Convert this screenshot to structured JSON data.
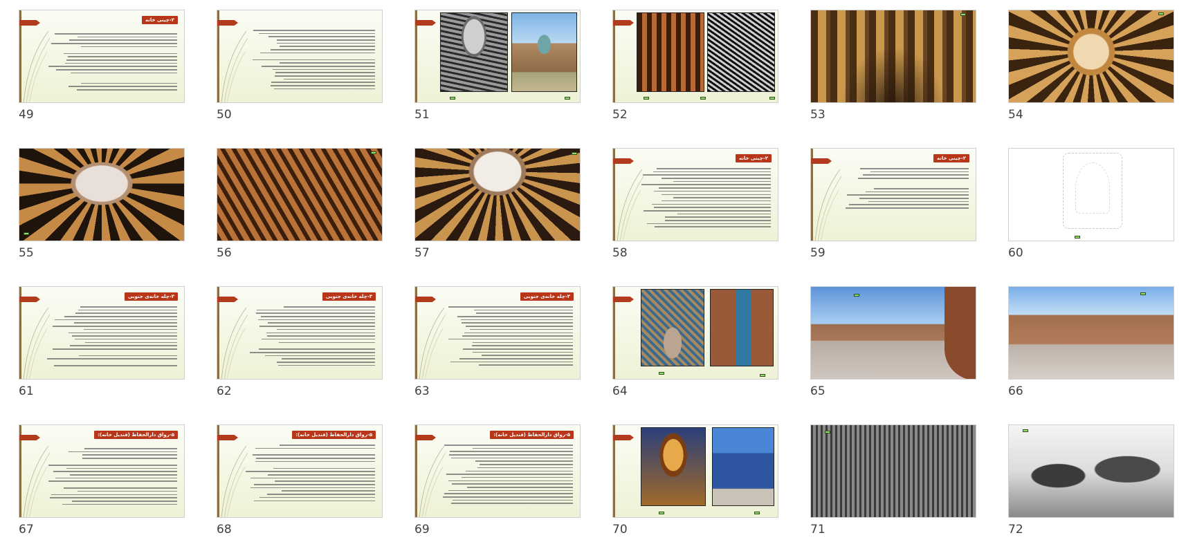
{
  "slides": [
    {
      "num": "49",
      "kind": "text",
      "title": "۲-چینی خانه",
      "layout": "full"
    },
    {
      "num": "50",
      "kind": "text",
      "title": "",
      "layout": "full"
    },
    {
      "num": "51",
      "kind": "two-photos",
      "captions": [
        "",
        "",
        ""
      ]
    },
    {
      "num": "52",
      "kind": "two-photos",
      "captions": [
        "",
        "",
        ""
      ]
    },
    {
      "num": "53",
      "kind": "photo",
      "scene": "interior-niches",
      "captions": [
        ""
      ]
    },
    {
      "num": "54",
      "kind": "photo",
      "scene": "dome-niches",
      "captions": [
        ""
      ]
    },
    {
      "num": "55",
      "kind": "photo",
      "scene": "dome-white",
      "captions": [
        ""
      ]
    },
    {
      "num": "56",
      "kind": "photo",
      "scene": "muqarnas-warm",
      "captions": [
        ""
      ]
    },
    {
      "num": "57",
      "kind": "photo",
      "scene": "dome-wide",
      "captions": [
        ""
      ]
    },
    {
      "num": "58",
      "kind": "text",
      "title": "۲-چینی خانه",
      "layout": "full"
    },
    {
      "num": "59",
      "kind": "text",
      "title": "۲-چینی خانه",
      "layout": "short"
    },
    {
      "num": "60",
      "kind": "sketch",
      "captions": [
        ""
      ]
    },
    {
      "num": "61",
      "kind": "text",
      "title": "۳-چله خانه‌ی جنوبی",
      "layout": "full"
    },
    {
      "num": "62",
      "kind": "text",
      "title": "۳-چله خانه‌ی جنوبی",
      "layout": "full"
    },
    {
      "num": "63",
      "kind": "text",
      "title": "۳-چله خانه‌ی جنوبی",
      "layout": "full"
    },
    {
      "num": "64",
      "kind": "two-arches",
      "captions": [
        "",
        ""
      ]
    },
    {
      "num": "65",
      "kind": "photo",
      "scene": "courtyard",
      "captions": [
        ""
      ]
    },
    {
      "num": "66",
      "kind": "photo",
      "scene": "courtyard2",
      "captions": [
        ""
      ]
    },
    {
      "num": "67",
      "kind": "text",
      "title": "۵-رواق دارالحفاظ (قندیل خانه):",
      "layout": "full"
    },
    {
      "num": "68",
      "kind": "text",
      "title": "۵-رواق دارالحفاظ (قندیل خانه):",
      "layout": "full"
    },
    {
      "num": "69",
      "kind": "text",
      "title": "۵-رواق دارالحفاظ (قندیل خانه):",
      "layout": "full"
    },
    {
      "num": "70",
      "kind": "two-tiles",
      "captions": [
        "",
        ""
      ]
    },
    {
      "num": "71",
      "kind": "photo",
      "scene": "bw-facade",
      "captions": [
        ""
      ]
    },
    {
      "num": "72",
      "kind": "photo",
      "scene": "bw-domes",
      "captions": [
        ""
      ]
    }
  ],
  "colors": {
    "title_bg": "#b8361a",
    "caption_bg": "#8fe16a",
    "slide_bg": "#eef2d6"
  }
}
